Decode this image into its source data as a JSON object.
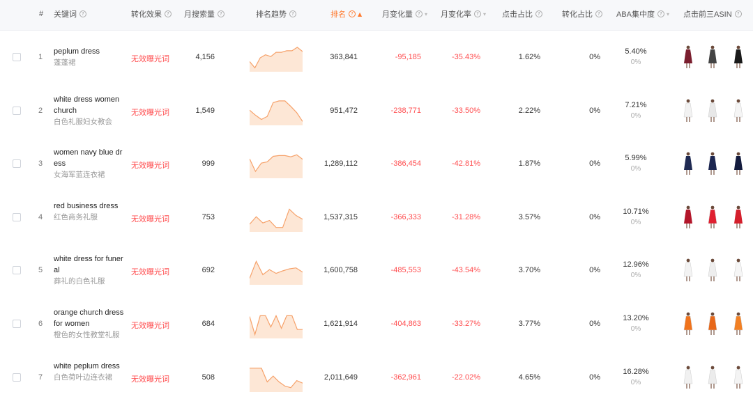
{
  "columns": [
    {
      "key": "index",
      "label": "#",
      "help": false
    },
    {
      "key": "keyword",
      "label": "关键词",
      "help": true
    },
    {
      "key": "conversion",
      "label": "转化效果",
      "help": true
    },
    {
      "key": "monthly_search",
      "label": "月搜索量",
      "help": true
    },
    {
      "key": "trend",
      "label": "排名趋势",
      "help": true
    },
    {
      "key": "rank",
      "label": "排名",
      "help": true,
      "sorted": "asc"
    },
    {
      "key": "monthly_change",
      "label": "月变化量",
      "help": true,
      "sortable": true
    },
    {
      "key": "monthly_change_rate",
      "label": "月变化率",
      "help": true,
      "sortable": true
    },
    {
      "key": "click_share",
      "label": "点击占比",
      "help": true
    },
    {
      "key": "conversion_share",
      "label": "转化占比",
      "help": true
    },
    {
      "key": "aba",
      "label": "ABA集中度",
      "help": true,
      "sortable": true
    },
    {
      "key": "top3_asin",
      "label": "点击前三ASIN",
      "help": true
    }
  ],
  "accent_color": "#ff7a2e",
  "negative_color": "#ff4d4f",
  "rows": [
    {
      "index": "1",
      "keyword_en": "peplum dress",
      "keyword_cn": "蓬蓬裙",
      "conversion": "无效曝光词",
      "monthly_search": "4,156",
      "rank": "363,841",
      "monthly_change": "-95,185",
      "monthly_change_rate": "-35.43%",
      "click_share": "1.62%",
      "conversion_share": "0%",
      "aba": "5.40%",
      "aba_sub": "0%",
      "trend": [
        0.35,
        0.1,
        0.5,
        0.62,
        0.55,
        0.72,
        0.72,
        0.78,
        0.78,
        0.92,
        0.75
      ],
      "asin_colors": [
        "#7a1e2e",
        "#444444",
        "#1a1a1a"
      ]
    },
    {
      "index": "2",
      "keyword_en": "white dress women church",
      "keyword_cn": "白色礼服妇女教会",
      "conversion": "无效曝光词",
      "monthly_search": "1,549",
      "rank": "951,472",
      "monthly_change": "-238,771",
      "monthly_change_rate": "-33.50%",
      "click_share": "2.22%",
      "conversion_share": "0%",
      "aba": "7.21%",
      "aba_sub": "0%",
      "trend": [
        0.55,
        0.35,
        0.18,
        0.3,
        0.85,
        0.92,
        0.92,
        0.7,
        0.45,
        0.1
      ],
      "asin_colors": [
        "#f2f2f2",
        "#e8e8e8",
        "#f5f5f5"
      ]
    },
    {
      "index": "3",
      "keyword_en": "women navy blue dress",
      "keyword_cn": "女海军蓝连衣裙",
      "conversion": "无效曝光词",
      "monthly_search": "999",
      "rank": "1,289,112",
      "monthly_change": "-386,454",
      "monthly_change_rate": "-42.81%",
      "click_share": "1.87%",
      "conversion_share": "0%",
      "aba": "5.99%",
      "aba_sub": "0%",
      "trend": [
        0.72,
        0.22,
        0.55,
        0.6,
        0.82,
        0.85,
        0.85,
        0.8,
        0.88,
        0.7
      ],
      "asin_colors": [
        "#1f2a52",
        "#1c2650",
        "#141c3e"
      ]
    },
    {
      "index": "4",
      "keyword_en": "red business dress",
      "keyword_cn": "红色商务礼服",
      "conversion": "无效曝光词",
      "monthly_search": "753",
      "rank": "1,537,315",
      "monthly_change": "-366,333",
      "monthly_change_rate": "-31.28%",
      "click_share": "3.57%",
      "conversion_share": "0%",
      "aba": "10.71%",
      "aba_sub": "0%",
      "trend": [
        0.25,
        0.55,
        0.3,
        0.4,
        0.12,
        0.12,
        0.85,
        0.6,
        0.45
      ],
      "asin_colors": [
        "#b3162a",
        "#e02030",
        "#d41f2c"
      ]
    },
    {
      "index": "5",
      "keyword_en": "white dress for funeral",
      "keyword_cn": "葬礼的白色礼服",
      "conversion": "无效曝光词",
      "monthly_search": "692",
      "rank": "1,600,758",
      "monthly_change": "-485,553",
      "monthly_change_rate": "-43.54%",
      "click_share": "3.70%",
      "conversion_share": "0%",
      "aba": "12.96%",
      "aba_sub": "0%",
      "trend": [
        0.2,
        0.88,
        0.35,
        0.55,
        0.4,
        0.5,
        0.58,
        0.62,
        0.45
      ],
      "asin_colors": [
        "#f3f3f3",
        "#eeeeee",
        "#f6f6f6"
      ]
    },
    {
      "index": "6",
      "keyword_en": "orange church dress for women",
      "keyword_cn": "橙色的女性教堂礼服",
      "conversion": "无效曝光词",
      "monthly_search": "684",
      "rank": "1,621,914",
      "monthly_change": "-404,863",
      "monthly_change_rate": "-33.27%",
      "click_share": "3.77%",
      "conversion_share": "0%",
      "aba": "13.20%",
      "aba_sub": "0%",
      "trend": [
        0.82,
        0.1,
        0.85,
        0.85,
        0.4,
        0.85,
        0.35,
        0.85,
        0.85,
        0.3,
        0.3
      ],
      "asin_colors": [
        "#f0731c",
        "#e8681a",
        "#f28024"
      ]
    },
    {
      "index": "7",
      "keyword_en": "white peplum dress",
      "keyword_cn": "白色荷叶边连衣裙",
      "conversion": "无效曝光词",
      "monthly_search": "508",
      "rank": "2,011,649",
      "monthly_change": "-362,961",
      "monthly_change_rate": "-22.02%",
      "click_share": "4.65%",
      "conversion_share": "0%",
      "aba": "16.28%",
      "aba_sub": "0%",
      "trend": [
        0.9,
        0.9,
        0.9,
        0.35,
        0.58,
        0.35,
        0.18,
        0.12,
        0.4,
        0.3
      ],
      "asin_colors": [
        "#f1f1f1",
        "#ececec",
        "#f4f4f4"
      ]
    }
  ]
}
